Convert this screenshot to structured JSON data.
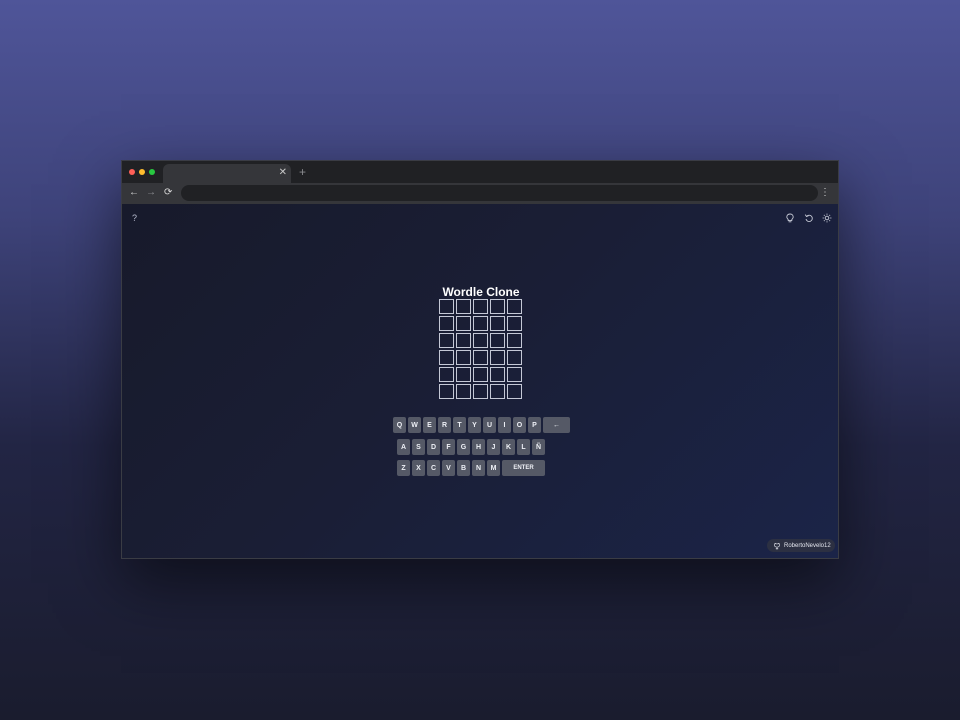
{
  "browser": {
    "tab_close": "✕",
    "new_tab": "+",
    "back": "←",
    "forward": "→",
    "reload": "⟳",
    "menu": "⋮"
  },
  "header": {
    "help": "?",
    "icons": [
      "lightbulb-icon",
      "undo-icon",
      "sun-icon"
    ]
  },
  "game": {
    "title": "Wordle Clone",
    "rows": 6,
    "cols": 5
  },
  "keyboard": {
    "row1": [
      "Q",
      "W",
      "E",
      "R",
      "T",
      "Y",
      "U",
      "I",
      "O",
      "P"
    ],
    "backspace": "←",
    "row2": [
      "A",
      "S",
      "D",
      "F",
      "G",
      "H",
      "J",
      "K",
      "L",
      "Ñ"
    ],
    "row3": [
      "Z",
      "X",
      "C",
      "V",
      "B",
      "N",
      "M"
    ],
    "enter": "ENTER"
  },
  "footer": {
    "github_user": "RobertoNevelo12"
  },
  "colors": {
    "key_bg": "#555966",
    "tile_border": "#c4c8d6",
    "accent_bg": "#4f5599"
  }
}
